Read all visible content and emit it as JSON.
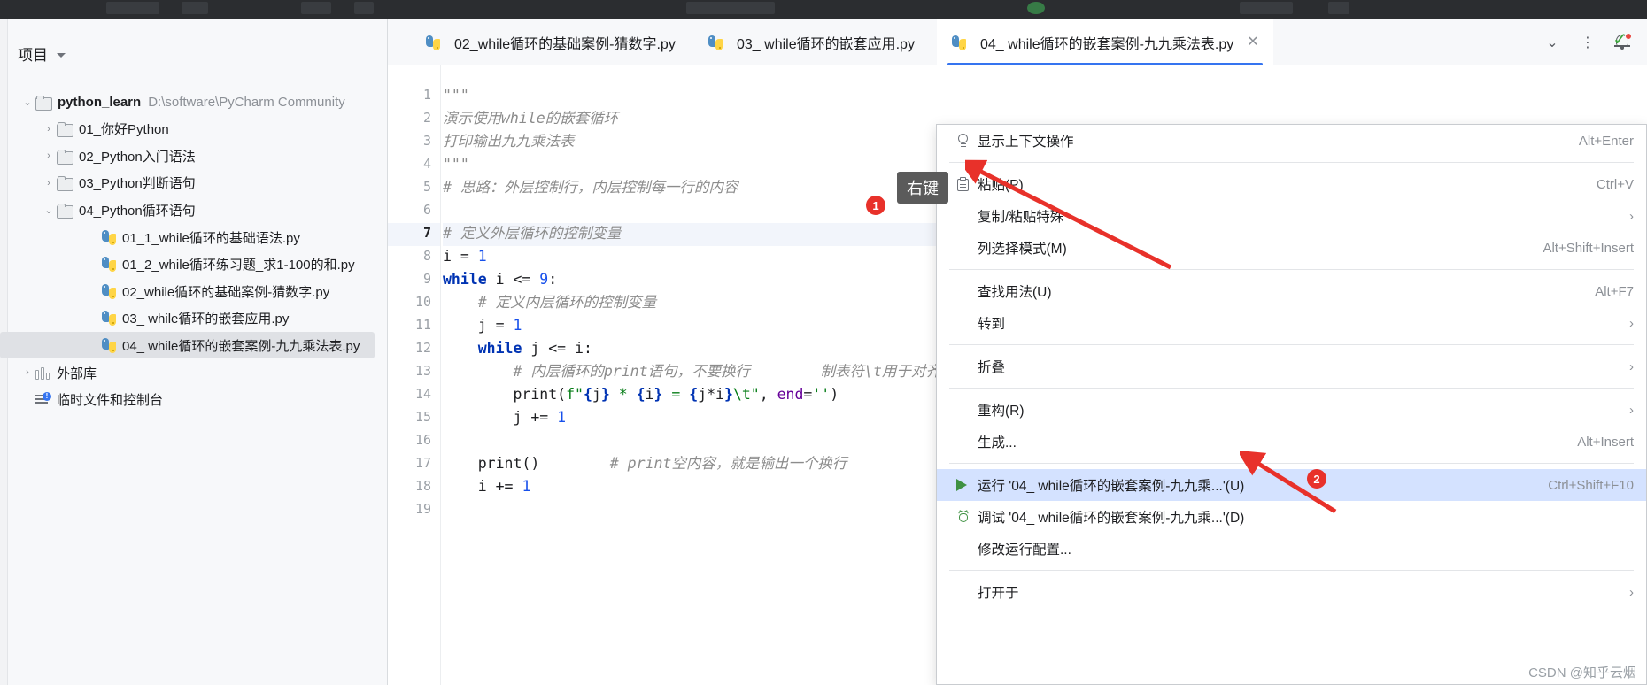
{
  "sidebar": {
    "panel_title": "项目",
    "tree": [
      {
        "indent": 0,
        "arrow": "v",
        "icon": "folder-icon",
        "label": "python_learn",
        "path": "D:\\software\\PyCharm Community",
        "bold": true,
        "selected": false
      },
      {
        "indent": 1,
        "arrow": ">",
        "icon": "folder-icon",
        "label": "01_你好Python",
        "path": "",
        "bold": false,
        "selected": false
      },
      {
        "indent": 1,
        "arrow": ">",
        "icon": "folder-icon",
        "label": "02_Python入门语法",
        "path": "",
        "bold": false,
        "selected": false
      },
      {
        "indent": 1,
        "arrow": ">",
        "icon": "folder-icon",
        "label": "03_Python判断语句",
        "path": "",
        "bold": false,
        "selected": false
      },
      {
        "indent": 1,
        "arrow": "v",
        "icon": "folder-icon",
        "label": "04_Python循环语句",
        "path": "",
        "bold": false,
        "selected": false
      },
      {
        "indent": 2,
        "arrow": "",
        "icon": "python-file-icon",
        "label": "01_1_while循环的基础语法.py",
        "path": "",
        "bold": false,
        "selected": false
      },
      {
        "indent": 2,
        "arrow": "",
        "icon": "python-file-icon",
        "label": "01_2_while循环练习题_求1-100的和.py",
        "path": "",
        "bold": false,
        "selected": false
      },
      {
        "indent": 2,
        "arrow": "",
        "icon": "python-file-icon",
        "label": "02_while循环的基础案例-猜数字.py",
        "path": "",
        "bold": false,
        "selected": false
      },
      {
        "indent": 2,
        "arrow": "",
        "icon": "python-file-icon",
        "label": "03_ while循环的嵌套应用.py",
        "path": "",
        "bold": false,
        "selected": false
      },
      {
        "indent": 2,
        "arrow": "",
        "icon": "python-file-icon",
        "label": "04_ while循环的嵌套案例-九九乘法表.py",
        "path": "",
        "bold": false,
        "selected": true
      },
      {
        "indent": 0,
        "arrow": ">",
        "icon": "external-libraries-icon",
        "label": "外部库",
        "path": "",
        "bold": false,
        "selected": false
      },
      {
        "indent": 0,
        "arrow": "",
        "icon": "scratches-icon",
        "label": "临时文件和控制台",
        "path": "",
        "bold": false,
        "selected": false
      }
    ]
  },
  "tabs": [
    {
      "label": "02_while循环的基础案例-猜数字.py",
      "active": false,
      "closable": false
    },
    {
      "label": "03_ while循环的嵌套应用.py",
      "active": false,
      "closable": false
    },
    {
      "label": "04_ while循环的嵌套案例-九九乘法表.py",
      "active": true,
      "closable": true
    }
  ],
  "tab_controls": {
    "close_label": "✕",
    "dropdown_label": "⌄",
    "more_label": "⋮"
  },
  "editor": {
    "current_line": 7,
    "inspection_status": "✓",
    "lines": [
      {
        "n": 1,
        "html": "<span class='doc'>\"\"\"</span>"
      },
      {
        "n": 2,
        "html": "<span class='doc'>演示使用while的嵌套循环</span>"
      },
      {
        "n": 3,
        "html": "<span class='doc'>打印输出九九乘法表</span>"
      },
      {
        "n": 4,
        "html": "<span class='doc'>\"\"\"</span>"
      },
      {
        "n": 5,
        "html": "<span class='cmt'># 思路：外层控制行，内层控制每一行的内容</span>"
      },
      {
        "n": 6,
        "html": ""
      },
      {
        "n": 7,
        "html": "<span class='cmt'># 定义外层循环的控制变量</span>"
      },
      {
        "n": 8,
        "html": "<span class='fn'>i</span> <span class='fn'>=</span> <span class='num'>1</span>"
      },
      {
        "n": 9,
        "html": "<span class='kw'>while</span> <span class='fn'>i</span> <span class='fn'>&lt;=</span> <span class='num'>9</span><span class='fn'>:</span>"
      },
      {
        "n": 10,
        "html": "    <span class='cmt'># 定义内层循环的控制变量</span>"
      },
      {
        "n": 11,
        "html": "    <span class='fn'>j</span> <span class='fn'>=</span> <span class='num'>1</span>"
      },
      {
        "n": 12,
        "html": "    <span class='kw'>while</span> <span class='fn'>j</span> <span class='fn'>&lt;=</span> <span class='fn'>i</span><span class='fn'>:</span>"
      },
      {
        "n": 13,
        "html": "        <span class='cmt'># 内层循环的print语句，不要换行</span>        <span class='cmt'>制表符\\t用于对齐</span>"
      },
      {
        "n": 14,
        "html": "        <span class='fn'>print(</span><span class='str'>f\"</span><span class='kw'>{</span><span class='fn'>j</span><span class='kw'>}</span><span class='str'> </span><span class='str'>*</span><span class='str'> </span><span class='kw'>{</span><span class='fn'>i</span><span class='kw'>}</span><span class='str'> = </span><span class='kw'>{</span><span class='fn'>j*i</span><span class='kw'>}</span><span class='str'>\\t\"</span><span class='fn'>, </span><span class='kwarg'>end</span><span class='fn'>=</span><span class='str'>''</span><span class='fn'>)</span>"
      },
      {
        "n": 15,
        "html": "        <span class='fn'>j</span> <span class='fn'>+=</span> <span class='num'>1</span>"
      },
      {
        "n": 16,
        "html": ""
      },
      {
        "n": 17,
        "html": "    <span class='fn'>print()</span>        <span class='cmt'># print空内容，就是输出一个换行</span>"
      },
      {
        "n": 18,
        "html": "    <span class='fn'>i</span> <span class='fn'>+=</span> <span class='num'>1</span>"
      },
      {
        "n": 19,
        "html": ""
      }
    ]
  },
  "context_menu": {
    "items": [
      {
        "type": "item",
        "icon": "lightbulb-icon",
        "label": "显示上下文操作",
        "shortcut": "Alt+Enter",
        "submenu": false,
        "highlight": false
      },
      {
        "type": "sep"
      },
      {
        "type": "item",
        "icon": "clipboard-icon",
        "label": "粘贴(P)",
        "shortcut": "Ctrl+V",
        "submenu": false,
        "highlight": false
      },
      {
        "type": "item",
        "icon": "",
        "label": "复制/粘贴特殊",
        "shortcut": "",
        "submenu": true,
        "highlight": false
      },
      {
        "type": "item",
        "icon": "",
        "label": "列选择模式(M)",
        "shortcut": "Alt+Shift+Insert",
        "submenu": false,
        "highlight": false
      },
      {
        "type": "sep"
      },
      {
        "type": "item",
        "icon": "",
        "label": "查找用法(U)",
        "shortcut": "Alt+F7",
        "submenu": false,
        "highlight": false
      },
      {
        "type": "item",
        "icon": "",
        "label": "转到",
        "shortcut": "",
        "submenu": true,
        "highlight": false
      },
      {
        "type": "sep"
      },
      {
        "type": "item",
        "icon": "",
        "label": "折叠",
        "shortcut": "",
        "submenu": true,
        "highlight": false
      },
      {
        "type": "sep"
      },
      {
        "type": "item",
        "icon": "",
        "label": "重构(R)",
        "shortcut": "",
        "submenu": true,
        "highlight": false
      },
      {
        "type": "item",
        "icon": "",
        "label": "生成...",
        "shortcut": "Alt+Insert",
        "submenu": false,
        "highlight": false
      },
      {
        "type": "sep"
      },
      {
        "type": "item",
        "icon": "run-icon",
        "label": "运行 '04_ while循环的嵌套案例-九九乘...'(U)",
        "shortcut": "Ctrl+Shift+F10",
        "submenu": false,
        "highlight": true
      },
      {
        "type": "item",
        "icon": "debug-icon",
        "label": "调试 '04_ while循环的嵌套案例-九九乘...'(D)",
        "shortcut": "",
        "submenu": false,
        "highlight": false
      },
      {
        "type": "item",
        "icon": "",
        "label": "修改运行配置...",
        "shortcut": "",
        "submenu": false,
        "highlight": false
      },
      {
        "type": "sep"
      },
      {
        "type": "item",
        "icon": "",
        "label": "打开于",
        "shortcut": "",
        "submenu": true,
        "highlight": false
      }
    ]
  },
  "annotations": [
    {
      "badge": "1",
      "tip": "右键"
    },
    {
      "badge": "2",
      "tip": ""
    }
  ],
  "watermark": "CSDN @知乎云烟",
  "colors": {
    "accent": "#3574f0",
    "badge_red": "#e8312a",
    "menu_highlight": "#d4e2ff",
    "tree_selected": "#dfe1e5",
    "keyword": "#0033b3",
    "string": "#067d17",
    "comment": "#8c8c8c",
    "number": "#1750eb"
  }
}
